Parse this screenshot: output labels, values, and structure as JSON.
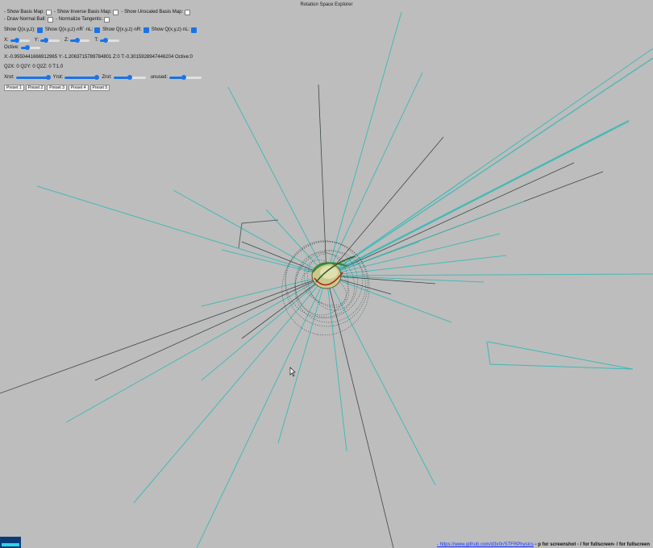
{
  "title": "Rotation Space Explorer",
  "options_row1": [
    {
      "label": "Show Basis Map:",
      "checked": false
    },
    {
      "label": "Show Inverse Basis Map:",
      "checked": false
    },
    {
      "label": "Show Unscaled Basis Map:",
      "checked": false
    }
  ],
  "options_row2": [
    {
      "label": "Draw Normal Ball:",
      "checked": false
    },
    {
      "label": "Normalize Tangents:",
      "checked": false
    }
  ],
  "show_row": [
    {
      "label": "Show Q(x,y,z):",
      "checked": true
    },
    {
      "label": "Show Q(x,y,z)·nR´·nL:",
      "checked": true
    },
    {
      "label": "Show Q(x,y,z)·nR:",
      "checked": true
    },
    {
      "label": "Show Q(x,y,z)·nL:",
      "checked": true
    }
  ],
  "sliders_xyzt": [
    {
      "label": "X:",
      "value": 0.35
    },
    {
      "label": "Y:",
      "value": 0.3
    },
    {
      "label": "Z:",
      "value": 0.35
    },
    {
      "label": "T:",
      "value": 0.3
    }
  ],
  "octive_slider": {
    "label": "Octive:",
    "value": 0.35
  },
  "readout_main": "X:-0.9550441666912965 Y:-1.2063715789784801 Z:0 T:-0.3015928947446204 Octive:0",
  "readout_q": "Q2X: 0  Q2Y: 0  Q2Z: 0  T:1.0",
  "rot_sliders": [
    {
      "label": "Xrot:",
      "value": 1.0
    },
    {
      "label": "Yrot:",
      "value": 1.0
    },
    {
      "label": "Zrot:",
      "value": 0.5
    },
    {
      "label": "unused:",
      "value": 0.45
    }
  ],
  "presets": [
    "Preset 1",
    "Preset 2",
    "Preset 3",
    "Preset 4",
    "Preset 5"
  ],
  "footer": {
    "link_text": "- https://www.github.com/d3x0r/STFRPhysics",
    "hint": " - p for screenshot - / for fullscreen- / for fullscreen"
  },
  "colors": {
    "background": "#bdbdbd",
    "accent": "#1a73e8",
    "line_cyan": "#3cb8b8",
    "line_dark": "#2f3b3b",
    "line_gray": "#5a6666"
  }
}
